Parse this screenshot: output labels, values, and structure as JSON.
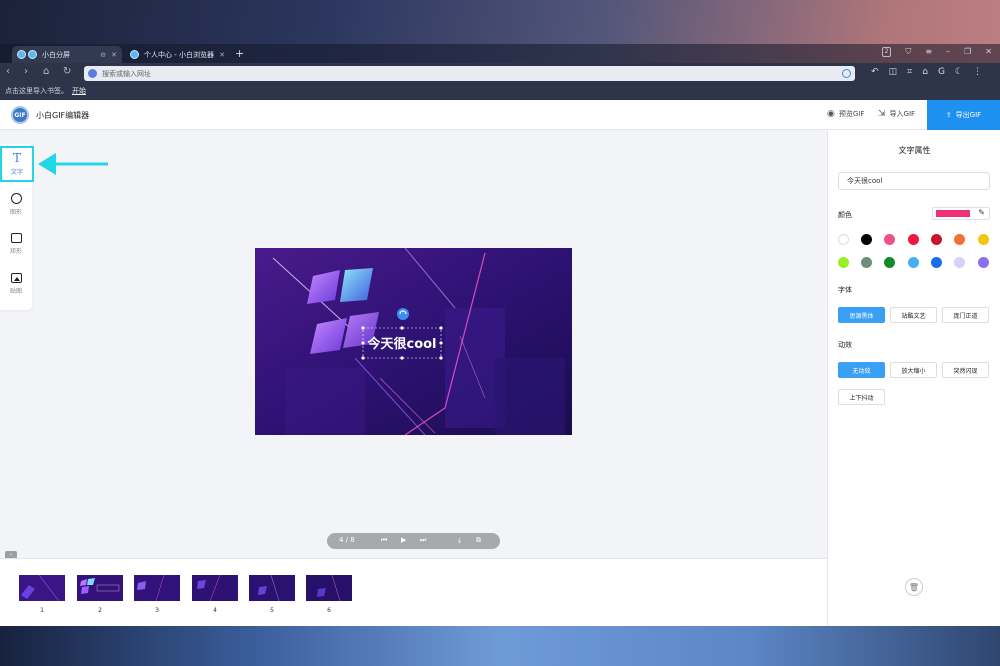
{
  "browser": {
    "tabs": [
      {
        "label": "小白分屏"
      },
      {
        "label": "个人中心 - 小白浏览器"
      }
    ],
    "tab_count": "2",
    "new_tab": "+",
    "address_placeholder": "搜索或输入网址",
    "bookmarks_hint": "点击这里导入书签。",
    "bookmarks_link": "开始"
  },
  "app": {
    "logo_text": "GIF",
    "title": "小白GIF编辑器",
    "preview_label": "预览GIF",
    "import_label": "导入GIF",
    "export_label": "导出GIF"
  },
  "tools": [
    {
      "glyph": "T",
      "label": "文字"
    },
    {
      "label": "图形"
    },
    {
      "label": "矩形"
    },
    {
      "label": "贴图"
    }
  ],
  "canvas": {
    "overlay_text": "今天很cool"
  },
  "player": {
    "counter": "4 / 8"
  },
  "frames": [
    "1",
    "2",
    "3",
    "4",
    "5",
    "6"
  ],
  "panel": {
    "title": "文字属性",
    "text_value": "今天很cool",
    "color_label": "颜色",
    "current_color": "#f0317a",
    "palette": [
      "#ffffff",
      "#000000",
      "#f0508a",
      "#f0173e",
      "#c8142c",
      "#f07038",
      "#f5c50a",
      "#98f020",
      "#6e8e7a",
      "#138a2a",
      "#48aef0",
      "#1a6ee8",
      "#dcd0f8",
      "#8a70f0"
    ],
    "font_label": "字体",
    "fonts": [
      "思源黑体",
      "站酷文艺",
      "庞门正道"
    ],
    "anim_label": "动效",
    "animations": [
      "无动效",
      "放大缩小",
      "突然闪现",
      "上下抖动"
    ]
  }
}
